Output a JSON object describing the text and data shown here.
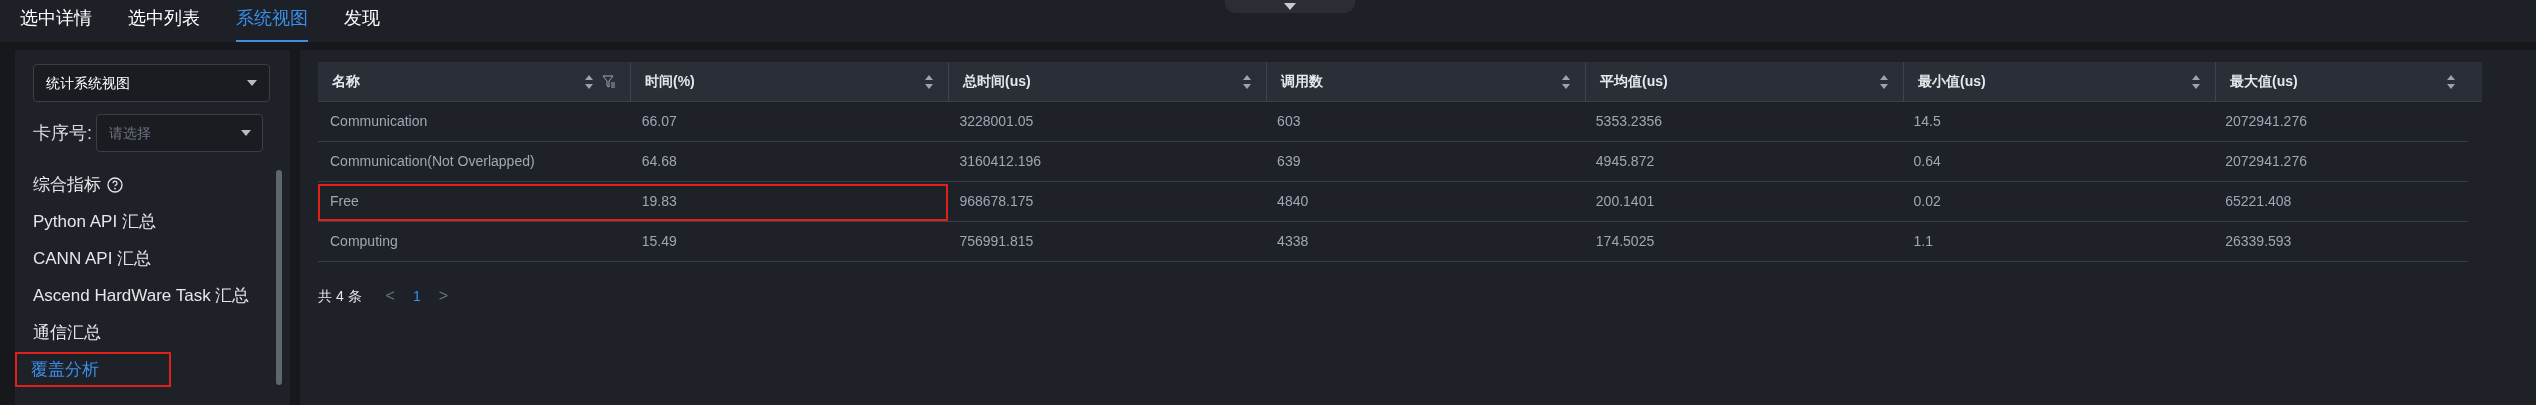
{
  "tabs": [
    {
      "label": "选中详情",
      "selected": false
    },
    {
      "label": "选中列表",
      "selected": false
    },
    {
      "label": "系统视图",
      "selected": true
    },
    {
      "label": "发现",
      "selected": false
    }
  ],
  "sidebar": {
    "view_select": {
      "value": "统计系统视图"
    },
    "card_select": {
      "label": "卡序号:",
      "placeholder": "请选择"
    },
    "items": [
      {
        "label": "综合指标",
        "help": true,
        "selected": false,
        "annotated": false
      },
      {
        "label": "Python API 汇总",
        "help": false,
        "selected": false,
        "annotated": false
      },
      {
        "label": "CANN API 汇总",
        "help": false,
        "selected": false,
        "annotated": false
      },
      {
        "label": "Ascend HardWare Task 汇总",
        "help": false,
        "selected": false,
        "annotated": false
      },
      {
        "label": "通信汇总",
        "help": false,
        "selected": false,
        "annotated": false
      },
      {
        "label": "覆盖分析",
        "help": false,
        "selected": true,
        "annotated": true
      }
    ]
  },
  "table": {
    "columns": [
      {
        "label": "名称",
        "filter": true
      },
      {
        "label": "时间(%)",
        "filter": false
      },
      {
        "label": "总时间(us)",
        "filter": false
      },
      {
        "label": "调用数",
        "filter": false
      },
      {
        "label": "平均值(us)",
        "filter": false
      },
      {
        "label": "最小值(us)",
        "filter": false
      },
      {
        "label": "最大值(us)",
        "filter": false
      }
    ],
    "rows": [
      {
        "annotated": false,
        "cells": [
          "Communication",
          "66.07",
          "3228001.05",
          "603",
          "5353.2356",
          "14.5",
          "2072941.276"
        ]
      },
      {
        "annotated": false,
        "cells": [
          "Communication(Not Overlapped)",
          "64.68",
          "3160412.196",
          "639",
          "4945.872",
          "0.64",
          "2072941.276"
        ]
      },
      {
        "annotated": true,
        "cells": [
          "Free",
          "19.83",
          "968678.175",
          "4840",
          "200.1401",
          "0.02",
          "65221.408"
        ]
      },
      {
        "annotated": false,
        "cells": [
          "Computing",
          "15.49",
          "756991.815",
          "4338",
          "174.5025",
          "1.1",
          "26339.593"
        ]
      }
    ]
  },
  "pagination": {
    "total": "共 4 条",
    "prev": "<",
    "pages": [
      {
        "label": "1",
        "selected": true
      }
    ],
    "next": ">"
  }
}
